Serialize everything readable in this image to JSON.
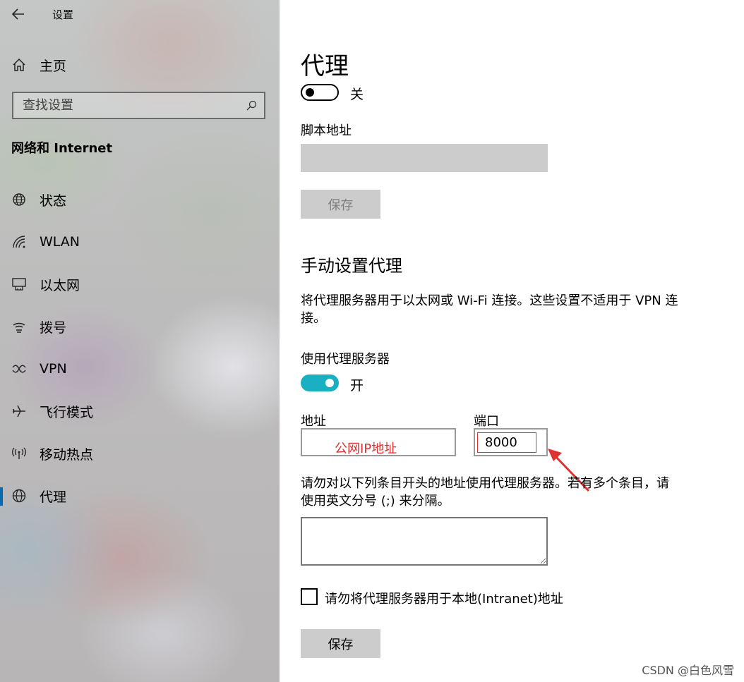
{
  "window": {
    "title": "设置"
  },
  "sidebar": {
    "home_label": "主页",
    "search_placeholder": "查找设置",
    "section_title": "网络和 Internet",
    "items": [
      {
        "label": "状态",
        "icon": "globe-status-icon"
      },
      {
        "label": "WLAN",
        "icon": "wifi-icon"
      },
      {
        "label": "以太网",
        "icon": "ethernet-icon"
      },
      {
        "label": "拨号",
        "icon": "dialup-icon"
      },
      {
        "label": "VPN",
        "icon": "vpn-icon"
      },
      {
        "label": "飞行模式",
        "icon": "airplane-icon"
      },
      {
        "label": "移动热点",
        "icon": "hotspot-icon"
      },
      {
        "label": "代理",
        "icon": "globe-icon",
        "active": true
      }
    ]
  },
  "main": {
    "title": "代理",
    "auto_detect": {
      "state_label": "关",
      "on": false
    },
    "script_address_label": "脚本地址",
    "save_top_label": "保存",
    "manual_heading": "手动设置代理",
    "manual_desc_line1": "将代理服务器用于以太网或 Wi-Fi 连接。这些设置不适用于 VPN 连",
    "manual_desc_line2": "接。",
    "use_proxy_label": "使用代理服务器",
    "use_proxy": {
      "state_label": "开",
      "on": true
    },
    "address_label": "地址",
    "address_annotation": "公网IP地址",
    "port_label": "端口",
    "port_value": "8000",
    "exceptions_desc_line1": "请勿对以下列条目开头的地址使用代理服务器。若有多个条目，请",
    "exceptions_desc_line2": "使用英文分号 (;) 来分隔。",
    "local_bypass_label": "请勿将代理服务器用于本地(Intranet)地址",
    "save_bottom_label": "保存"
  },
  "watermark": "CSDN @白色风雪",
  "colors": {
    "toggle_on": "#1aafc1",
    "annotation": "#e0302f",
    "active_indicator": "#0a6ab0"
  }
}
